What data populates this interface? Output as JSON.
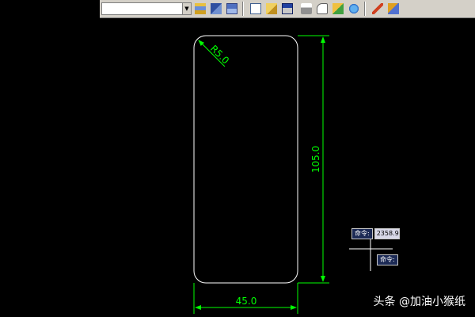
{
  "toolbar": {
    "icons": [
      "layer-stack-icon",
      "layer-properties-icon",
      "layer-previous-icon",
      "new-file-icon",
      "open-file-icon",
      "save-icon",
      "print-icon",
      "print-preview-icon",
      "publish-icon",
      "globe-icon",
      "pencil-icon",
      "match-properties-icon"
    ]
  },
  "drawing": {
    "line_color": "#ffffff",
    "dimension_color": "#00ff00",
    "dim_radius": "R5.0",
    "dim_height": "105.0",
    "dim_width": "45.0"
  },
  "command": {
    "prompt_label": "命令:",
    "prompt_value": "2358.9",
    "prompt_label_2": "命令:"
  },
  "watermark": {
    "text": "头条 @加油小猴纸"
  }
}
